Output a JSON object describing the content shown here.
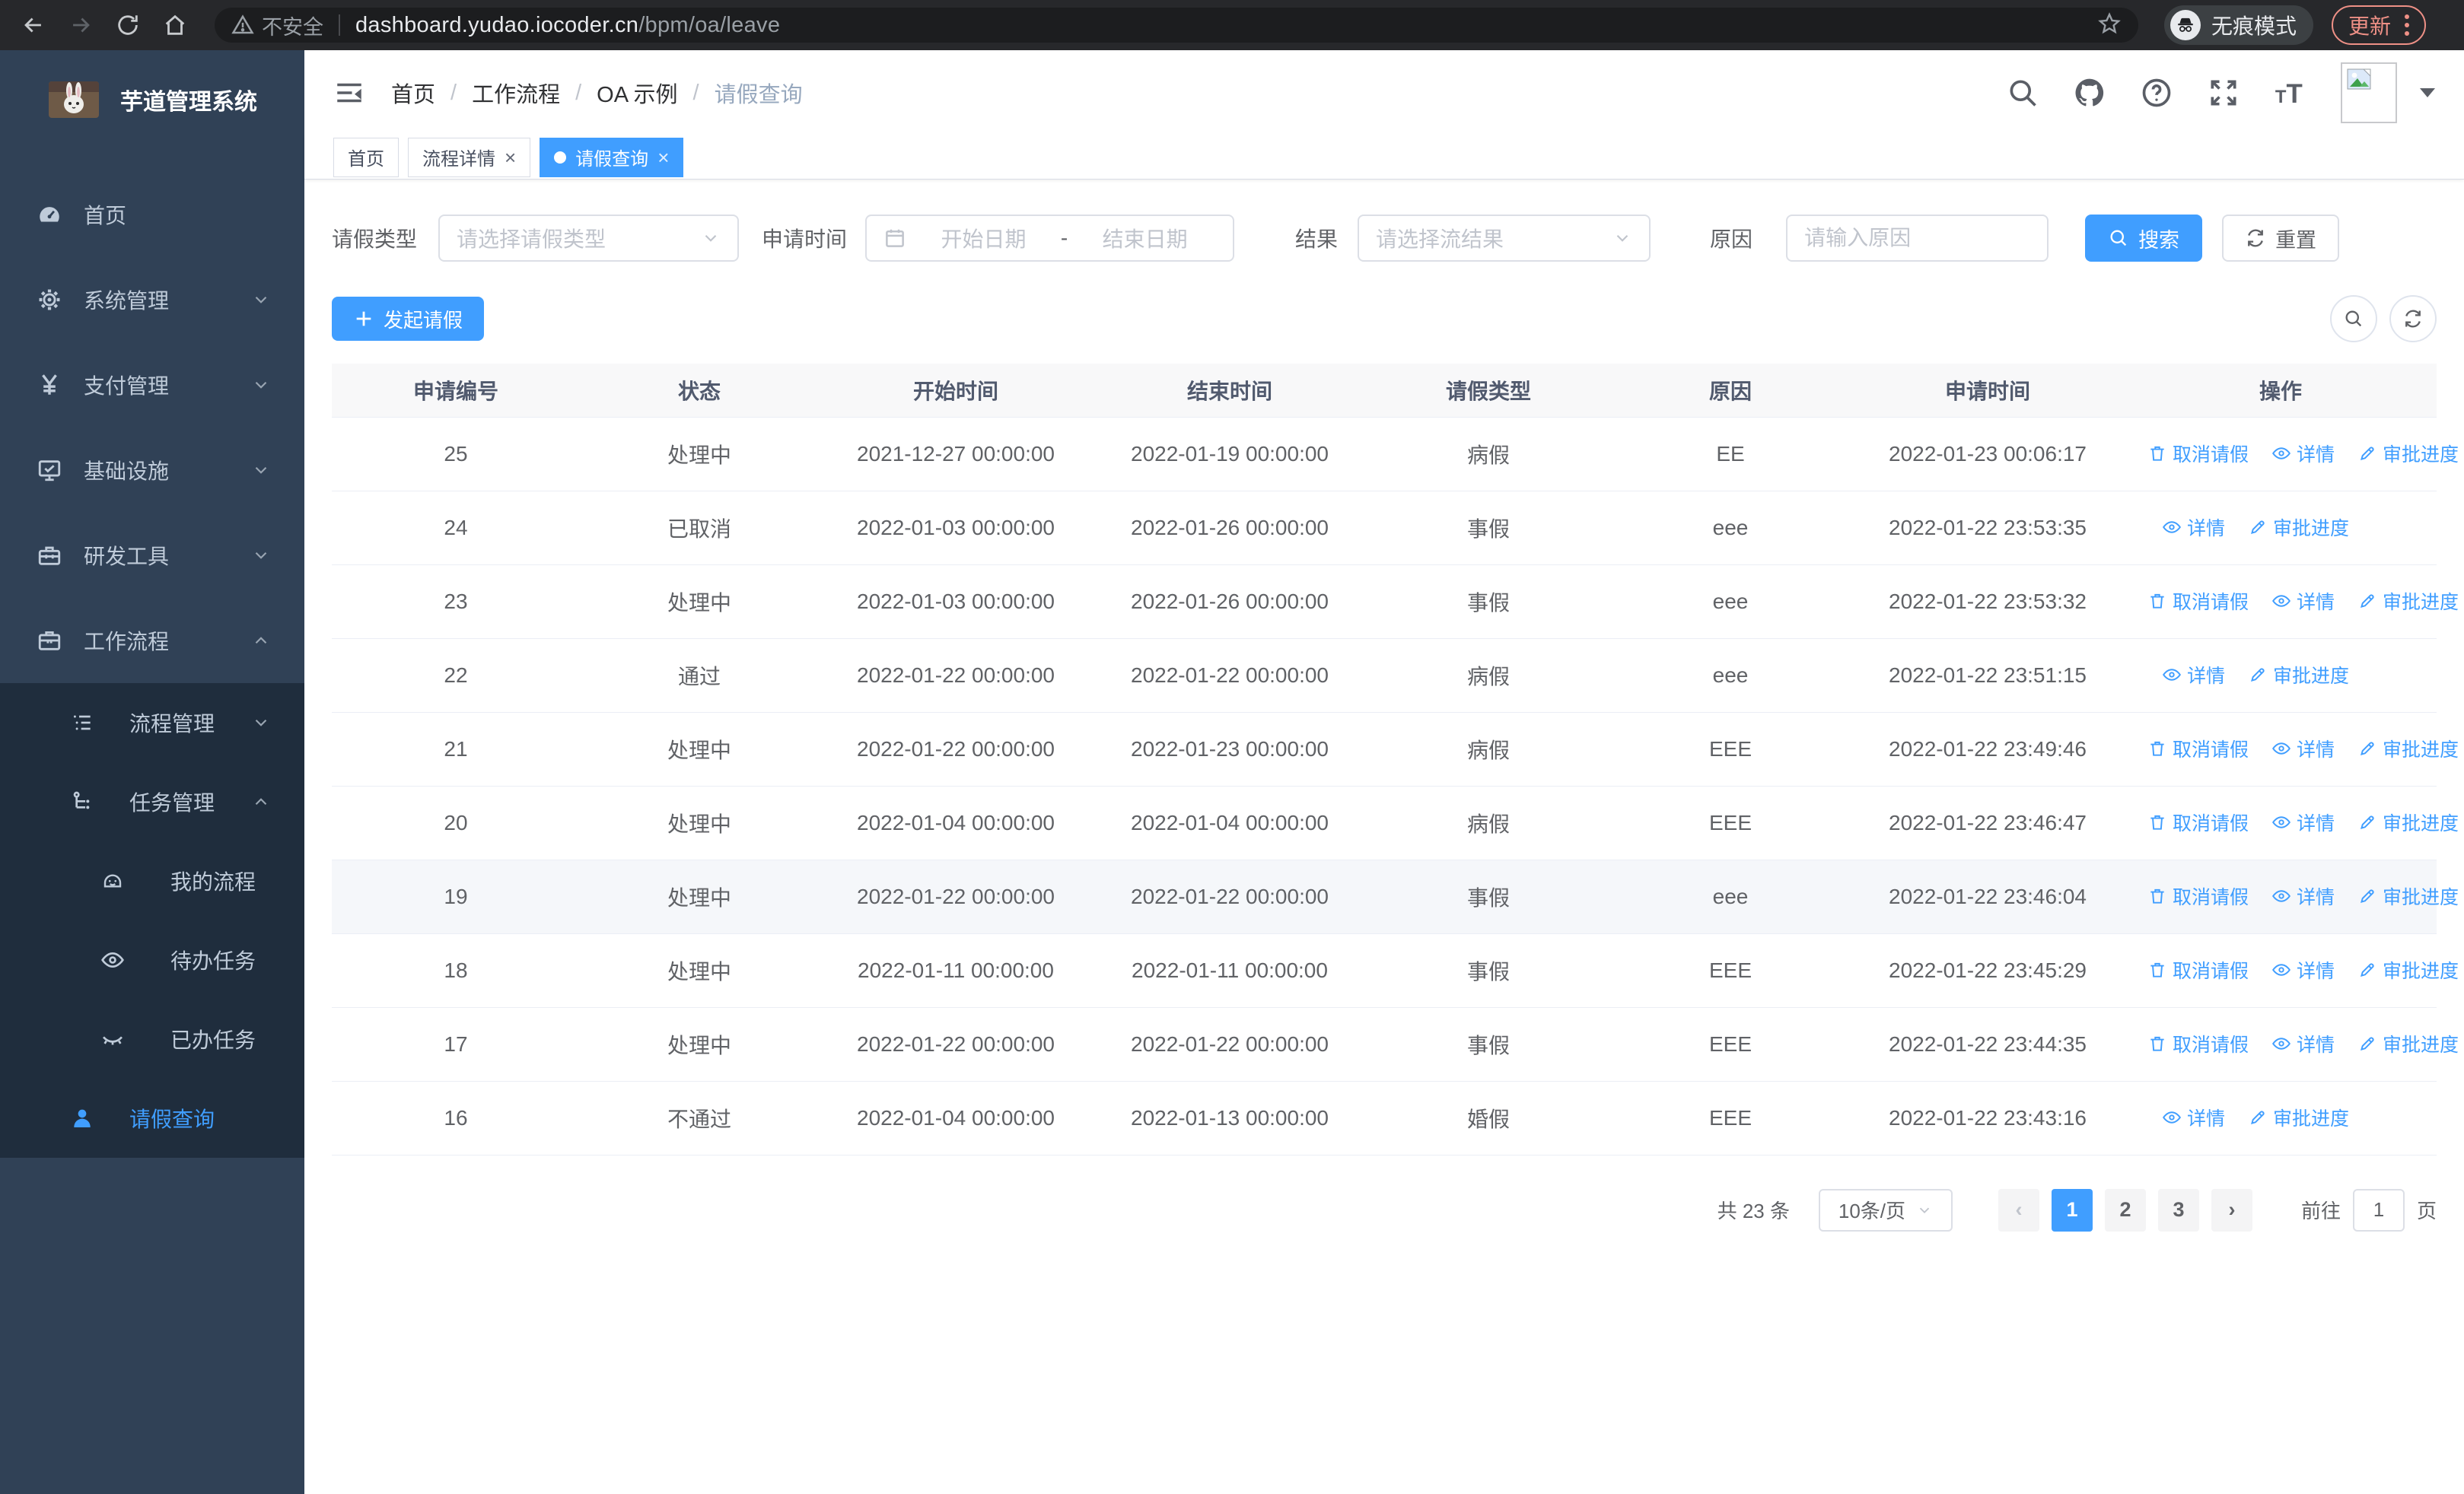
{
  "browser": {
    "security_warning": "不安全",
    "url_host": "dashboard.yudao.iocoder.cn",
    "url_path": "/bpm/oa/leave",
    "incognito_label": "无痕模式",
    "update_label": "更新"
  },
  "sidebar": {
    "app_title": "芋道管理系统",
    "menu": [
      {
        "label": "首页",
        "icon": "dashboard-icon",
        "level": 1,
        "chevron": null,
        "group": false,
        "active": false
      },
      {
        "label": "系统管理",
        "icon": "gear-icon",
        "level": 1,
        "chevron": "down",
        "group": false,
        "active": false
      },
      {
        "label": "支付管理",
        "icon": "yen-icon",
        "level": 1,
        "chevron": "down",
        "group": false,
        "active": false
      },
      {
        "label": "基础设施",
        "icon": "monitor-icon",
        "level": 1,
        "chevron": "down",
        "group": false,
        "active": false
      },
      {
        "label": "研发工具",
        "icon": "toolbox-icon",
        "level": 1,
        "chevron": "down",
        "group": false,
        "active": false
      },
      {
        "label": "工作流程",
        "icon": "briefcase-icon",
        "level": 1,
        "chevron": "up",
        "group": false,
        "active": false
      },
      {
        "label": "流程管理",
        "icon": "list-icon",
        "level": 2,
        "chevron": "down",
        "group": true,
        "active": false
      },
      {
        "label": "任务管理",
        "icon": "tree-icon",
        "level": 2,
        "chevron": "up",
        "group": true,
        "active": false
      },
      {
        "label": "我的流程",
        "icon": "robot-icon",
        "level": 3,
        "chevron": null,
        "group": true,
        "active": false
      },
      {
        "label": "待办任务",
        "icon": "eye-open-icon",
        "level": 3,
        "chevron": null,
        "group": true,
        "active": false
      },
      {
        "label": "已办任务",
        "icon": "eye-closed-icon",
        "level": 3,
        "chevron": null,
        "group": true,
        "active": false
      },
      {
        "label": "请假查询",
        "icon": "person-icon",
        "level": 2,
        "chevron": null,
        "group": true,
        "active": true
      }
    ]
  },
  "breadcrumb": [
    "首页",
    "工作流程",
    "OA 示例",
    "请假查询"
  ],
  "tabs": [
    {
      "label": "首页",
      "closable": false,
      "active": false
    },
    {
      "label": "流程详情",
      "closable": true,
      "active": false
    },
    {
      "label": "请假查询",
      "closable": true,
      "active": true
    }
  ],
  "filters": {
    "leave_type_label": "请假类型",
    "leave_type_placeholder": "请选择请假类型",
    "apply_time_label": "申请时间",
    "start_placeholder": "开始日期",
    "range_separator": "-",
    "end_placeholder": "结束日期",
    "result_label": "结果",
    "result_placeholder": "请选择流结果",
    "reason_label": "原因",
    "reason_placeholder": "请输入原因",
    "search_label": "搜索",
    "reset_label": "重置"
  },
  "toolbar": {
    "create_label": "发起请假"
  },
  "table": {
    "headers": [
      "申请编号",
      "状态",
      "开始时间",
      "结束时间",
      "请假类型",
      "原因",
      "申请时间",
      "操作"
    ],
    "action_labels": {
      "cancel": "取消请假",
      "detail": "详情",
      "progress": "审批进度"
    },
    "rows": [
      {
        "id": "25",
        "status": "处理中",
        "start": "2021-12-27 00:00:00",
        "end": "2022-01-19 00:00:00",
        "type": "病假",
        "reason": "EE",
        "apply_time": "2022-01-23 00:06:17",
        "actions": [
          "cancel",
          "detail",
          "progress"
        ],
        "highlighted": false
      },
      {
        "id": "24",
        "status": "已取消",
        "start": "2022-01-03 00:00:00",
        "end": "2022-01-26 00:00:00",
        "type": "事假",
        "reason": "eee",
        "apply_time": "2022-01-22 23:53:35",
        "actions": [
          "detail",
          "progress"
        ],
        "highlighted": false
      },
      {
        "id": "23",
        "status": "处理中",
        "start": "2022-01-03 00:00:00",
        "end": "2022-01-26 00:00:00",
        "type": "事假",
        "reason": "eee",
        "apply_time": "2022-01-22 23:53:32",
        "actions": [
          "cancel",
          "detail",
          "progress"
        ],
        "highlighted": false
      },
      {
        "id": "22",
        "status": "通过",
        "start": "2022-01-22 00:00:00",
        "end": "2022-01-22 00:00:00",
        "type": "病假",
        "reason": "eee",
        "apply_time": "2022-01-22 23:51:15",
        "actions": [
          "detail",
          "progress"
        ],
        "highlighted": false
      },
      {
        "id": "21",
        "status": "处理中",
        "start": "2022-01-22 00:00:00",
        "end": "2022-01-23 00:00:00",
        "type": "病假",
        "reason": "EEE",
        "apply_time": "2022-01-22 23:49:46",
        "actions": [
          "cancel",
          "detail",
          "progress"
        ],
        "highlighted": false
      },
      {
        "id": "20",
        "status": "处理中",
        "start": "2022-01-04 00:00:00",
        "end": "2022-01-04 00:00:00",
        "type": "病假",
        "reason": "EEE",
        "apply_time": "2022-01-22 23:46:47",
        "actions": [
          "cancel",
          "detail",
          "progress"
        ],
        "highlighted": false
      },
      {
        "id": "19",
        "status": "处理中",
        "start": "2022-01-22 00:00:00",
        "end": "2022-01-22 00:00:00",
        "type": "事假",
        "reason": "eee",
        "apply_time": "2022-01-22 23:46:04",
        "actions": [
          "cancel",
          "detail",
          "progress"
        ],
        "highlighted": true
      },
      {
        "id": "18",
        "status": "处理中",
        "start": "2022-01-11 00:00:00",
        "end": "2022-01-11 00:00:00",
        "type": "事假",
        "reason": "EEE",
        "apply_time": "2022-01-22 23:45:29",
        "actions": [
          "cancel",
          "detail",
          "progress"
        ],
        "highlighted": false
      },
      {
        "id": "17",
        "status": "处理中",
        "start": "2022-01-22 00:00:00",
        "end": "2022-01-22 00:00:00",
        "type": "事假",
        "reason": "EEE",
        "apply_time": "2022-01-22 23:44:35",
        "actions": [
          "cancel",
          "detail",
          "progress"
        ],
        "highlighted": false
      },
      {
        "id": "16",
        "status": "不通过",
        "start": "2022-01-04 00:00:00",
        "end": "2022-01-13 00:00:00",
        "type": "婚假",
        "reason": "EEE",
        "apply_time": "2022-01-22 23:43:16",
        "actions": [
          "detail",
          "progress"
        ],
        "highlighted": false
      }
    ]
  },
  "pagination": {
    "total_text": "共 23 条",
    "page_size": "10条/页",
    "prev": "‹",
    "pages": [
      "1",
      "2",
      "3"
    ],
    "active": "1",
    "next": "›",
    "goto_label": "前往",
    "goto_value": "1",
    "unit": "页"
  }
}
